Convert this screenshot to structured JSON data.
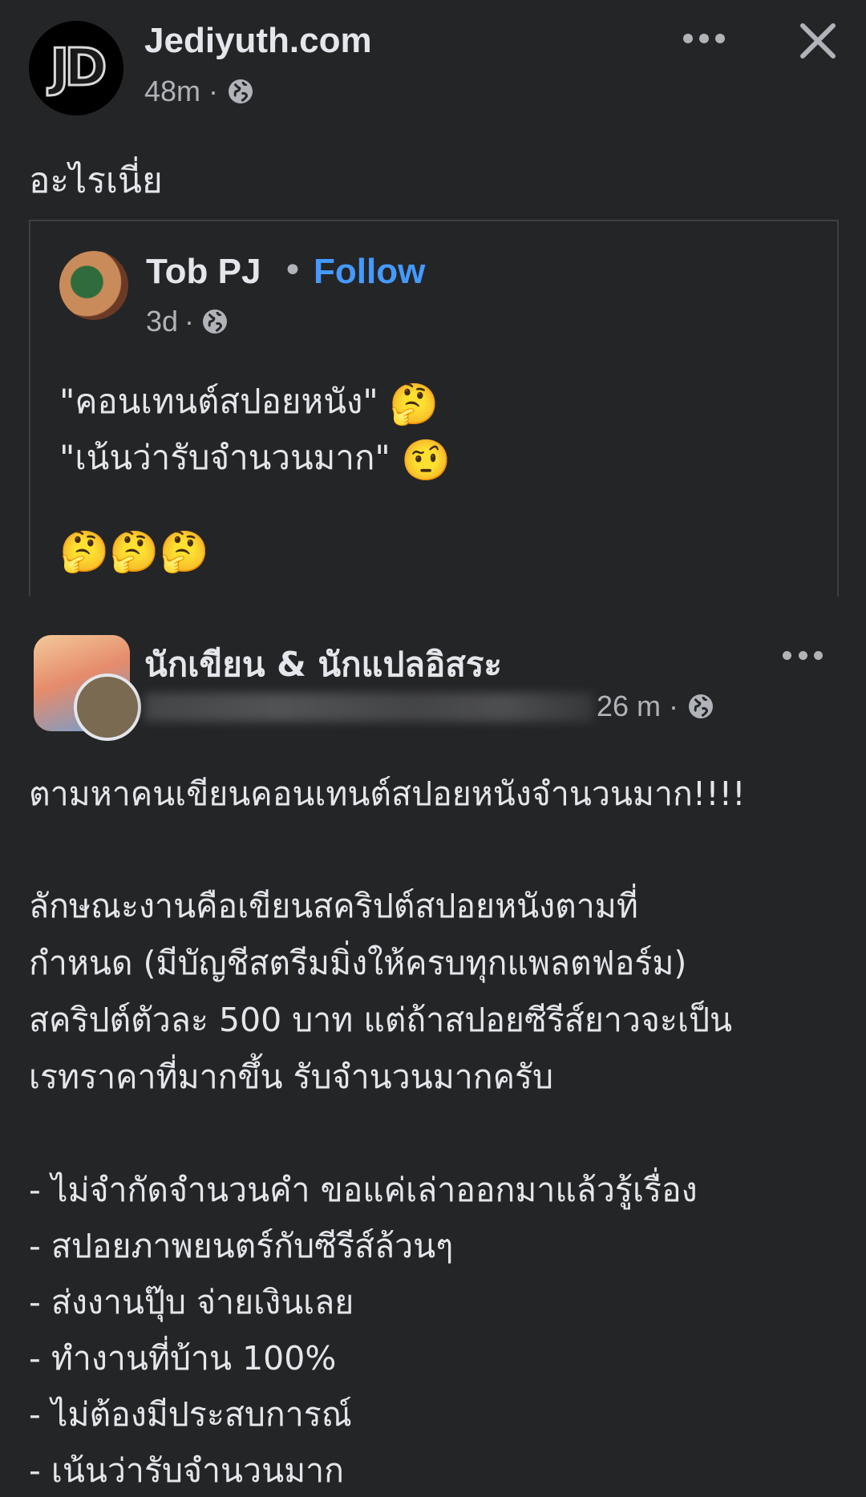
{
  "header": {
    "avatar_text": "JD",
    "page_name": "Jediyuth.com",
    "time": "48m",
    "separator": "·",
    "post_text": "อะไรเนี่ย"
  },
  "shared_post": {
    "author": "Tob PJ",
    "separator": "•",
    "follow_label": "Follow",
    "time": "3d",
    "meta_separator": "·",
    "line1": "\"คอนเทนต์สปอยหนัง\"",
    "line1_emoji": "🤔",
    "line2": "\"เน้นว่ารับจำนวนมาก\"",
    "line2_emoji": "🤨",
    "line3_emoji": "🤔🤔🤔"
  },
  "embedded_post": {
    "group_name": "นักเขียน & นักแปลอิสระ",
    "time": "26 m",
    "separator": "·",
    "body_lines": [
      "ตามหาคนเขียนคอนเทนต์สปอยหนังจำนวนมาก!!!!",
      "",
      "ลักษณะงานคือเขียนสคริปต์สปอยหนังตามที่",
      "กำหนด (มีบัญชีสตรีมมิ่งให้ครบทุกแพลตฟอร์ม)",
      "สคริปต์ตัวละ 500 บาท แต่ถ้าสปอยซีรีส์ยาวจะเป็น",
      "เรทราคาที่มากขึ้น รับจำนวนมากครับ",
      "",
      "- ไม่จำกัดจำนวนคำ ขอแค่เล่าออกมาแล้วรู้เรื่อง",
      "- สปอยภาพยนตร์กับซีรีส์ล้วนๆ",
      "- ส่งงานปุ๊บ จ่ายเงินเลย",
      "- ทำงานที่บ้าน 100%",
      "- ไม่ต้องมีประสบการณ์",
      "- เน้นว่ารับจำนวนมาก"
    ]
  },
  "icons": {
    "globe": "globe-icon",
    "more": "more-options-icon",
    "close": "close-icon"
  },
  "colors": {
    "background": "#242526",
    "text": "#e4e6eb",
    "secondary_text": "#b0b3b8",
    "follow_blue": "#4599ff",
    "border": "#3e4042"
  }
}
